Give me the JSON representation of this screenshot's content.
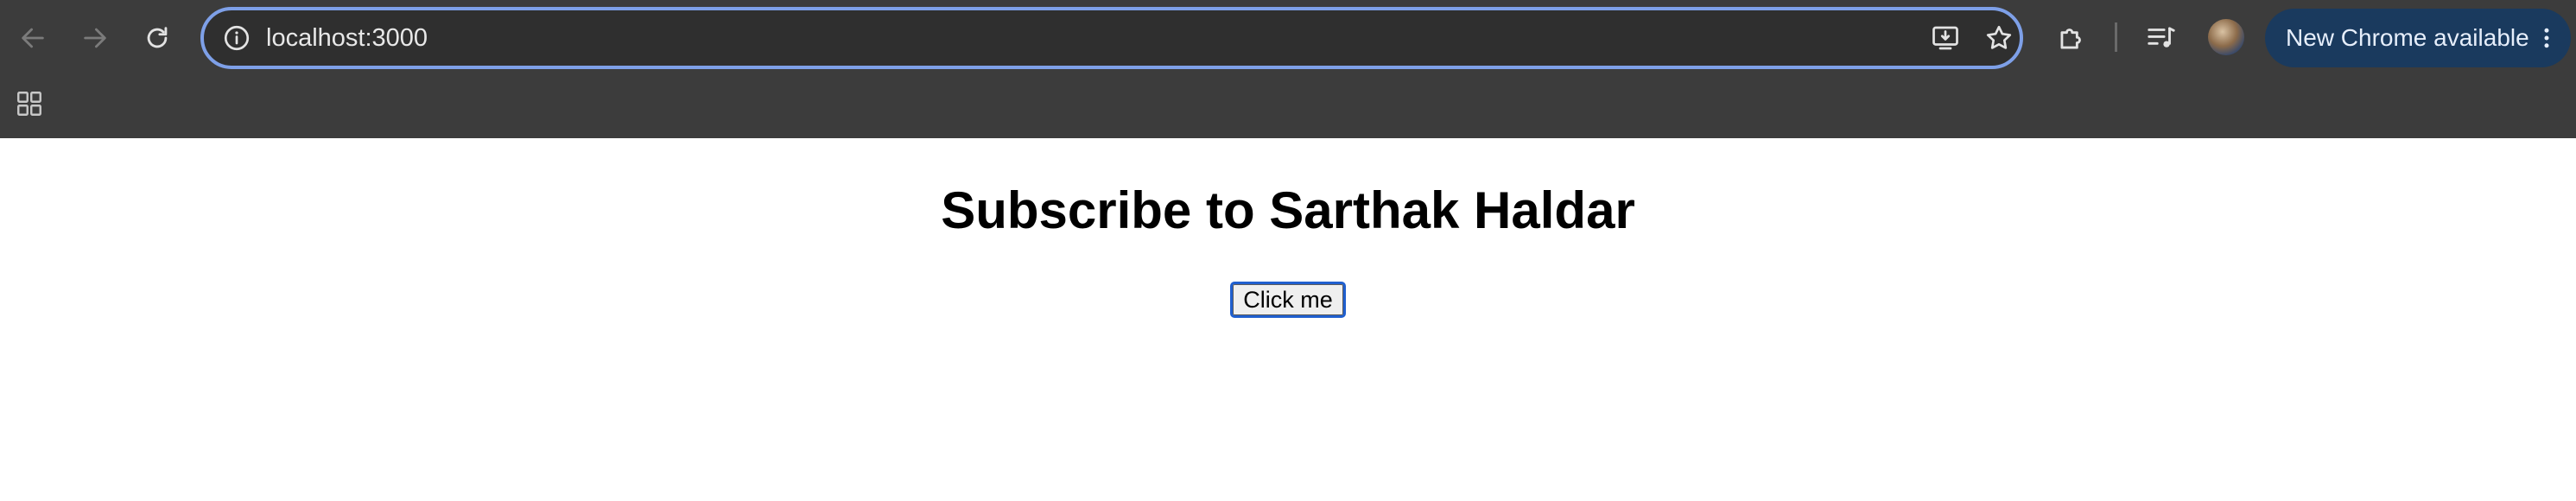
{
  "browser": {
    "address_bar": {
      "url": "localhost:3000"
    },
    "update_button": {
      "label": "New Chrome available"
    },
    "colors": {
      "toolbar": "#3c3c3c",
      "omnibox_focus_ring": "#7ea0e8",
      "update_pill": "#1a3a5e"
    },
    "icons": [
      "back-arrow-icon",
      "forward-arrow-icon",
      "reload-icon",
      "site-info-icon",
      "install-app-icon",
      "bookmark-star-icon",
      "extensions-puzzle-icon",
      "media-controls-icon",
      "profile-avatar",
      "kebab-menu-icon",
      "apps-grid-icon"
    ]
  },
  "page": {
    "title": "Subscribe to Sarthak Haldar",
    "button_label": "Click me"
  }
}
